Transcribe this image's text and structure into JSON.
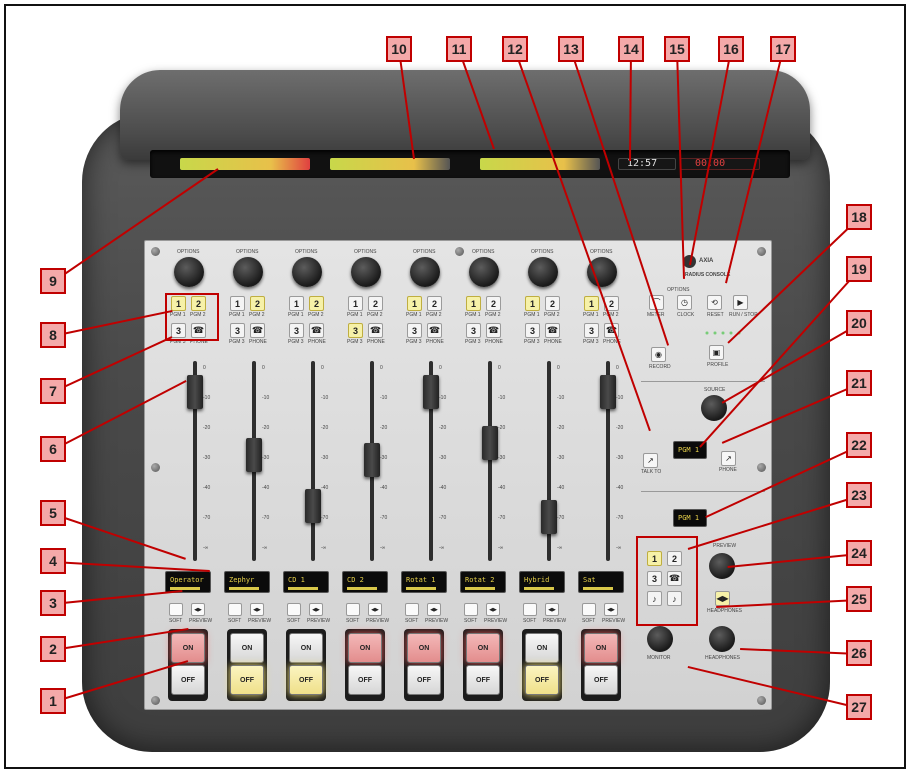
{
  "console": {
    "brand": "AXIA",
    "model": "RADIUS CONSOLE",
    "clock_display": "12:57",
    "timer_display": "00:00"
  },
  "colors": {
    "callout_fill": "#f4a9a9",
    "callout_border": "#c00000",
    "on_lit": "#e38d8d",
    "off_lit": "#efe08a",
    "selector_lit": "#f6f1a8",
    "oled_text": "#e6d04a"
  },
  "channels": [
    {
      "label": "Operator",
      "sel": [
        "1",
        "2",
        "3",
        "phone-icon"
      ],
      "lit": [
        0,
        1
      ],
      "fader": 0.92,
      "on_lit": true,
      "off_lit": false
    },
    {
      "label": "Zephyr",
      "sel": [
        "1",
        "2",
        "3",
        "phone-icon"
      ],
      "lit": [
        1
      ],
      "fader": 0.55,
      "on_lit": false,
      "off_lit": true
    },
    {
      "label": "CD 1",
      "sel": [
        "1",
        "2",
        "3",
        "phone-icon"
      ],
      "lit": [
        1
      ],
      "fader": 0.25,
      "on_lit": false,
      "off_lit": true
    },
    {
      "label": "CD 2",
      "sel": [
        "1",
        "2",
        "3",
        "phone-icon"
      ],
      "lit": [
        2
      ],
      "fader": 0.52,
      "on_lit": true,
      "off_lit": false
    },
    {
      "label": "Rotat 1",
      "sel": [
        "1",
        "2",
        "3",
        "phone-icon"
      ],
      "lit": [
        0
      ],
      "fader": 0.92,
      "on_lit": true,
      "off_lit": false
    },
    {
      "label": "Rotat 2",
      "sel": [
        "1",
        "2",
        "3",
        "phone-icon"
      ],
      "lit": [
        0
      ],
      "fader": 0.62,
      "on_lit": true,
      "off_lit": false
    },
    {
      "label": "Hybrid",
      "sel": [
        "1",
        "2",
        "3",
        "phone-icon"
      ],
      "lit": [
        0
      ],
      "fader": 0.18,
      "on_lit": false,
      "off_lit": true
    },
    {
      "label": "Sat",
      "sel": [
        "1",
        "2",
        "3",
        "phone-icon"
      ],
      "lit": [
        0
      ],
      "fader": 0.92,
      "on_lit": true,
      "off_lit": false
    }
  ],
  "labels": {
    "options": "OPTIONS",
    "pgm1": "PGM 1",
    "pgm2": "PGM 2",
    "pgm3": "PGM 3",
    "phone": "PHONE",
    "soft": "SOFT",
    "preview": "PREVIEW",
    "on": "ON",
    "off": "OFF",
    "meter": "METER",
    "clock": "CLOCK",
    "timer_reset": "RESET",
    "timer_run": "RUN / STOP",
    "record": "RECORD",
    "profile": "PROFILE",
    "source": "SOURCE",
    "talkback": "TALK TO",
    "phone_label": "PHONE",
    "monitor": "MONITOR",
    "headphones": "HEADPHONES",
    "cue": "CUE",
    "preview_section": "PREVIEW"
  },
  "fader_scale": [
    "0",
    "-10",
    "-20",
    "-30",
    "-40",
    "-70",
    "-∞"
  ],
  "monitor_source_display": "PGM 1",
  "monitor_source_display_2": "PGM 1",
  "callouts": [
    "1",
    "2",
    "3",
    "4",
    "5",
    "6",
    "7",
    "8",
    "9",
    "10",
    "11",
    "12",
    "13",
    "14",
    "15",
    "16",
    "17",
    "18",
    "19",
    "20",
    "21",
    "22",
    "23",
    "24",
    "25",
    "26",
    "27"
  ]
}
